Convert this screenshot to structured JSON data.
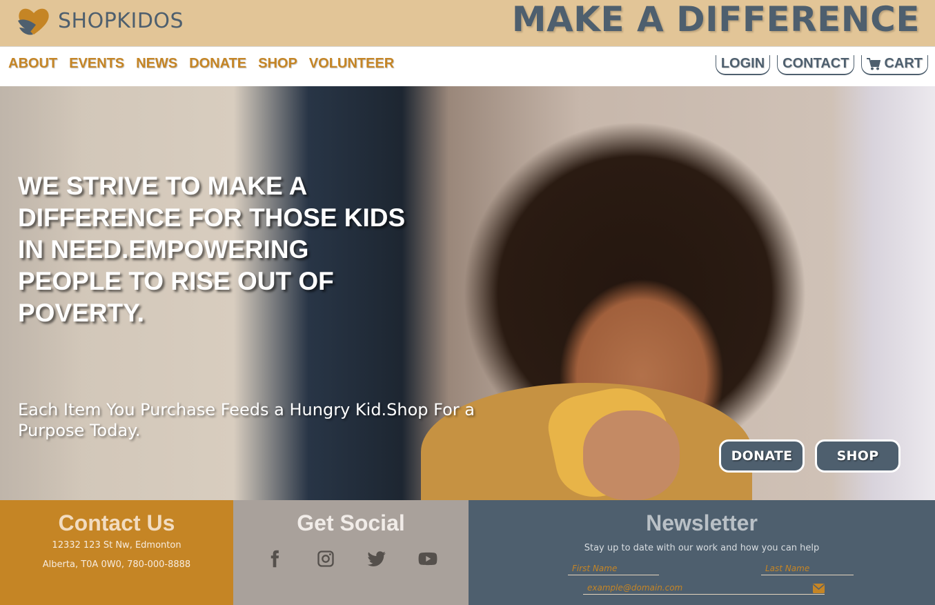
{
  "brand": {
    "name": "SHOPKIDOS",
    "tagline": "MAKE A DIFFERENCE"
  },
  "nav": {
    "left": [
      "ABOUT",
      "EVENTS",
      "NEWS",
      "DONATE",
      "SHOP",
      "VOLUNTEER"
    ],
    "login": "LOGIN",
    "contact": "CONTACT",
    "cart": "CART"
  },
  "hero": {
    "title": "WE STRIVE TO MAKE A DIFFERENCE FOR THOSE KIDS IN NEED.EMPOWERING PEOPLE TO RISE OUT OF POVERTY.",
    "subtitle": "Each Item You Purchase Feeds a Hungry Kid.Shop For a Purpose Today.",
    "donate_button": "DONATE",
    "shop_button": "SHOP"
  },
  "footer": {
    "contact": {
      "title": "Contact Us",
      "line1": "12332 123 St Nw, Edmonton",
      "line2": "Alberta, T0A 0W0, 780-000-8888"
    },
    "social": {
      "title": "Get Social",
      "icons": [
        "facebook-icon",
        "instagram-icon",
        "twitter-icon",
        "youtube-icon"
      ]
    },
    "newsletter": {
      "title": "Newsletter",
      "description": "Stay up to date with our work and how you can help",
      "first_name_placeholder": "First Name",
      "last_name_placeholder": "Last Name",
      "email_placeholder": "example@domain.com"
    }
  },
  "colors": {
    "topbar": "#e2c597",
    "slate": "#4e5f6e",
    "gold": "#c58525",
    "taupe": "#a9a19b"
  }
}
